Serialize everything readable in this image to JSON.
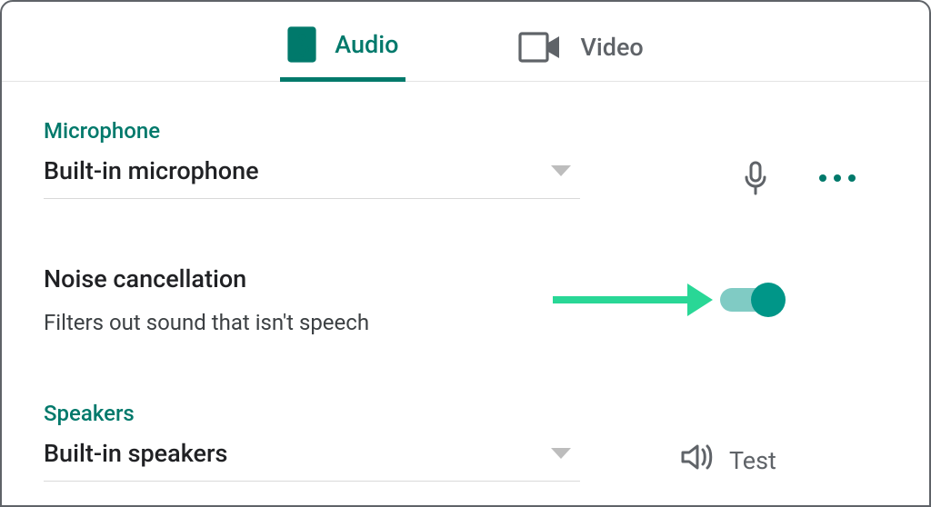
{
  "tabs": {
    "audio": "Audio",
    "video": "Video",
    "activeIndex": 0
  },
  "microphone": {
    "title": "Microphone",
    "selected": "Built-in microphone"
  },
  "noise": {
    "title": "Noise cancellation",
    "subtitle": "Filters out sound that isn't speech",
    "enabled": true
  },
  "speakers": {
    "title": "Speakers",
    "selected": "Built-in speakers",
    "test_label": "Test"
  },
  "colors": {
    "accent": "#00796b",
    "toggleThumb": "#009688",
    "arrow": "#29d796"
  }
}
